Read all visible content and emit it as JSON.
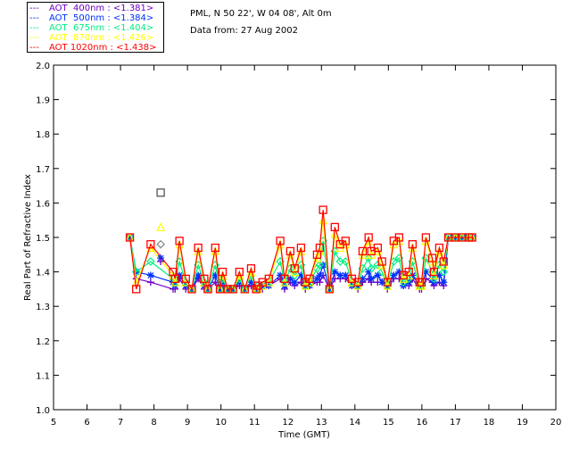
{
  "header": {
    "site": "PML, N 50 22', W 04 08', Alt 0m",
    "date": "Data from: 27 Aug 2002"
  },
  "legend": [
    {
      "label": "AOT  400nm : <1.381>",
      "color": "#7000c0",
      "marker": "plus"
    },
    {
      "label": "AOT  500nm : <1.384>",
      "color": "#0030ff",
      "marker": "asterisk"
    },
    {
      "label": "AOT  675nm : <1.404>",
      "color": "#00f080",
      "marker": "diamond"
    },
    {
      "label": "AOT  870nm : <1.426>",
      "color": "#ffff00",
      "marker": "triangle"
    },
    {
      "label": "AOT 1020nm : <1.438>",
      "color": "#ff0000",
      "marker": "square"
    }
  ],
  "chart_data": {
    "type": "line",
    "xlabel": "Time (GMT)",
    "ylabel": "Real Part of Refractive Index",
    "xlim": [
      5,
      20
    ],
    "ylim": [
      1.0,
      2.0
    ],
    "xticks": [
      "5",
      "6",
      "7",
      "8",
      "9",
      "10",
      "11",
      "12",
      "13",
      "14",
      "15",
      "16",
      "17",
      "18",
      "19",
      "20"
    ],
    "yticks": [
      "1.0",
      "1.1",
      "1.2",
      "1.3",
      "1.4",
      "1.5",
      "1.6",
      "1.7",
      "1.8",
      "1.9",
      "2.0"
    ],
    "x": [
      7.28,
      7.47,
      7.9,
      8.57,
      8.63,
      8.76,
      8.95,
      9.13,
      9.32,
      9.5,
      9.61,
      9.83,
      9.97,
      10.05,
      10.2,
      10.36,
      10.55,
      10.71,
      10.9,
      11.05,
      11.1,
      11.24,
      11.43,
      11.77,
      11.9,
      12.07,
      12.2,
      12.39,
      12.52,
      12.65,
      12.87,
      12.95,
      13.05,
      13.24,
      13.4,
      13.56,
      13.72,
      13.91,
      14.09,
      14.23,
      14.41,
      14.49,
      14.68,
      14.81,
      14.97,
      15.16,
      15.32,
      15.45,
      15.61,
      15.72,
      15.93,
      15.99,
      16.12,
      16.31,
      16.36,
      16.52,
      16.65,
      16.79,
      17.0,
      17.2,
      17.4,
      17.5
    ],
    "series": [
      {
        "name": "AOT  400nm",
        "values": [
          1.5,
          1.38,
          1.37,
          1.35,
          1.35,
          1.38,
          1.35,
          1.35,
          1.38,
          1.35,
          1.35,
          1.37,
          1.35,
          1.36,
          1.35,
          1.35,
          1.36,
          1.35,
          1.36,
          1.35,
          1.35,
          1.35,
          1.36,
          1.38,
          1.35,
          1.37,
          1.36,
          1.37,
          1.35,
          1.36,
          1.37,
          1.37,
          1.39,
          1.35,
          1.38,
          1.38,
          1.38,
          1.36,
          1.35,
          1.37,
          1.38,
          1.37,
          1.37,
          1.37,
          1.35,
          1.38,
          1.38,
          1.36,
          1.36,
          1.38,
          1.35,
          1.35,
          1.38,
          1.37,
          1.36,
          1.37,
          1.36,
          1.5,
          1.5,
          1.5,
          1.5,
          1.5
        ]
      },
      {
        "name": "AOT  500nm",
        "values": [
          1.5,
          1.4,
          1.39,
          1.37,
          1.36,
          1.39,
          1.36,
          1.35,
          1.39,
          1.36,
          1.35,
          1.39,
          1.35,
          1.37,
          1.35,
          1.35,
          1.37,
          1.35,
          1.37,
          1.35,
          1.35,
          1.36,
          1.36,
          1.39,
          1.36,
          1.38,
          1.37,
          1.39,
          1.36,
          1.36,
          1.38,
          1.39,
          1.42,
          1.35,
          1.4,
          1.39,
          1.39,
          1.36,
          1.36,
          1.38,
          1.4,
          1.38,
          1.39,
          1.37,
          1.36,
          1.39,
          1.4,
          1.36,
          1.37,
          1.39,
          1.36,
          1.36,
          1.4,
          1.38,
          1.37,
          1.39,
          1.37,
          1.5,
          1.5,
          1.5,
          1.5,
          1.5
        ]
      },
      {
        "name": "AOT  675nm",
        "values": [
          1.5,
          1.4,
          1.43,
          1.38,
          1.37,
          1.43,
          1.37,
          1.35,
          1.42,
          1.37,
          1.35,
          1.42,
          1.35,
          1.38,
          1.35,
          1.35,
          1.38,
          1.35,
          1.39,
          1.35,
          1.36,
          1.36,
          1.37,
          1.43,
          1.37,
          1.41,
          1.39,
          1.42,
          1.36,
          1.37,
          1.41,
          1.42,
          1.49,
          1.35,
          1.46,
          1.43,
          1.43,
          1.37,
          1.36,
          1.41,
          1.44,
          1.41,
          1.42,
          1.4,
          1.36,
          1.43,
          1.44,
          1.37,
          1.38,
          1.43,
          1.36,
          1.36,
          1.44,
          1.4,
          1.38,
          1.42,
          1.4,
          1.5,
          1.5,
          1.5,
          1.5,
          1.5
        ]
      },
      {
        "name": "AOT  870nm",
        "values": [
          1.5,
          1.37,
          1.47,
          1.39,
          1.37,
          1.48,
          1.37,
          1.35,
          1.46,
          1.37,
          1.35,
          1.46,
          1.35,
          1.39,
          1.35,
          1.35,
          1.39,
          1.35,
          1.4,
          1.35,
          1.35,
          1.36,
          1.37,
          1.48,
          1.37,
          1.45,
          1.4,
          1.46,
          1.36,
          1.37,
          1.44,
          1.46,
          1.55,
          1.35,
          1.51,
          1.47,
          1.48,
          1.37,
          1.36,
          1.45,
          1.49,
          1.45,
          1.46,
          1.42,
          1.36,
          1.48,
          1.49,
          1.38,
          1.39,
          1.47,
          1.36,
          1.36,
          1.49,
          1.43,
          1.39,
          1.46,
          1.42,
          1.5,
          1.5,
          1.5,
          1.5,
          1.5
        ]
      },
      {
        "name": "AOT 1020nm",
        "values": [
          1.5,
          1.35,
          1.48,
          1.4,
          1.38,
          1.49,
          1.38,
          1.35,
          1.47,
          1.38,
          1.35,
          1.47,
          1.35,
          1.4,
          1.35,
          1.35,
          1.4,
          1.35,
          1.41,
          1.35,
          1.36,
          1.37,
          1.38,
          1.49,
          1.38,
          1.46,
          1.41,
          1.47,
          1.37,
          1.38,
          1.45,
          1.47,
          1.58,
          1.35,
          1.53,
          1.48,
          1.49,
          1.38,
          1.37,
          1.46,
          1.5,
          1.46,
          1.47,
          1.43,
          1.37,
          1.49,
          1.5,
          1.39,
          1.4,
          1.48,
          1.37,
          1.37,
          1.5,
          1.44,
          1.4,
          1.47,
          1.43,
          1.5,
          1.5,
          1.5,
          1.5,
          1.5
        ]
      }
    ],
    "extra_points": [
      {
        "x": 8.2,
        "y": 1.63,
        "marker": "square",
        "color": "#555555"
      },
      {
        "x": 8.2,
        "y": 1.53,
        "marker": "triangle",
        "color": "#ffff00"
      },
      {
        "x": 8.2,
        "y": 1.48,
        "marker": "diamond",
        "color": "#888888"
      },
      {
        "x": 8.2,
        "y": 1.44,
        "marker": "asterisk",
        "color": "#0030ff"
      },
      {
        "x": 8.2,
        "y": 1.43,
        "marker": "plus",
        "color": "#7000c0"
      }
    ],
    "grid": false,
    "legend_position": "top-left"
  }
}
